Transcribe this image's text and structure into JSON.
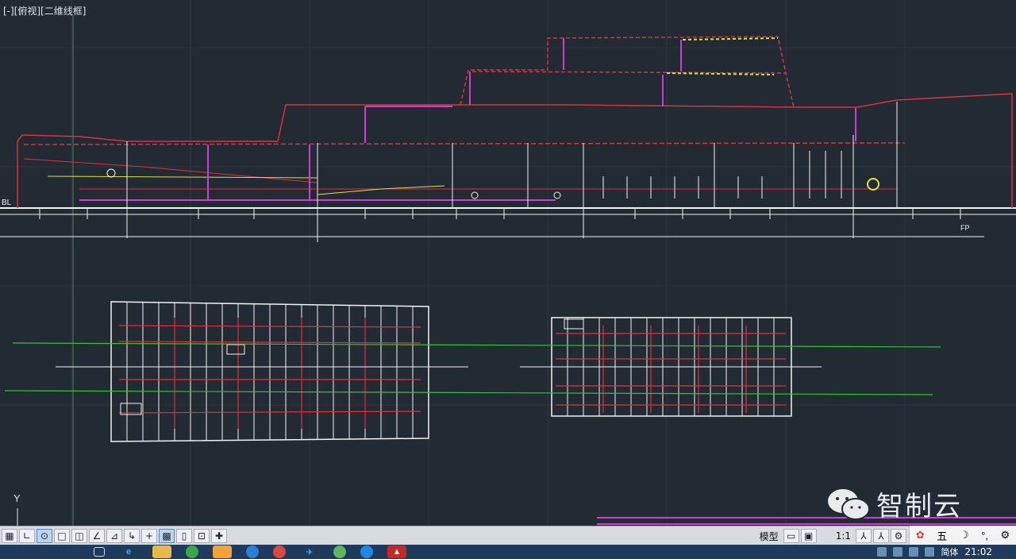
{
  "viewport": {
    "label": "[-][俯视][二维线框]"
  },
  "drawing": {
    "baseline_label": "BL",
    "fp_label": "FP",
    "axis_y_label": "Y",
    "colors": {
      "background": "#222a34",
      "red": "#e0303a",
      "white": "#f2f2f2",
      "magenta": "#d13ad6",
      "yellow": "#e3df3a",
      "green": "#33c233",
      "grid": "#2c3440"
    }
  },
  "watermark": {
    "text": "智制云",
    "icon": "wechat-logo-icon"
  },
  "statusbar": {
    "left_buttons": [
      "grid-icon",
      "snap-icon",
      "ortho-icon",
      "polar-icon",
      "osnap-icon",
      "otrack-icon",
      "ducs-icon",
      "dyn-icon",
      "lwt-icon",
      "tp-icon",
      "qp-icon",
      "sc-icon",
      "am-icon"
    ],
    "model_label": "模型",
    "scale_label": "1:1",
    "ime": {
      "char": "五",
      "icons": [
        "paw-icon",
        "moon-icon",
        "punct-icon",
        "gear-icon"
      ]
    }
  },
  "taskbar": {
    "apps": [
      "window-icon",
      "ie-icon",
      "folder-icon",
      "app-green-icon",
      "app-orange-icon",
      "app-bird-icon",
      "chrome-icon",
      "plane-icon",
      "app-leaf-icon",
      "app-blue-icon",
      "autocad-icon"
    ],
    "lang": "简体",
    "time": "21:02"
  }
}
